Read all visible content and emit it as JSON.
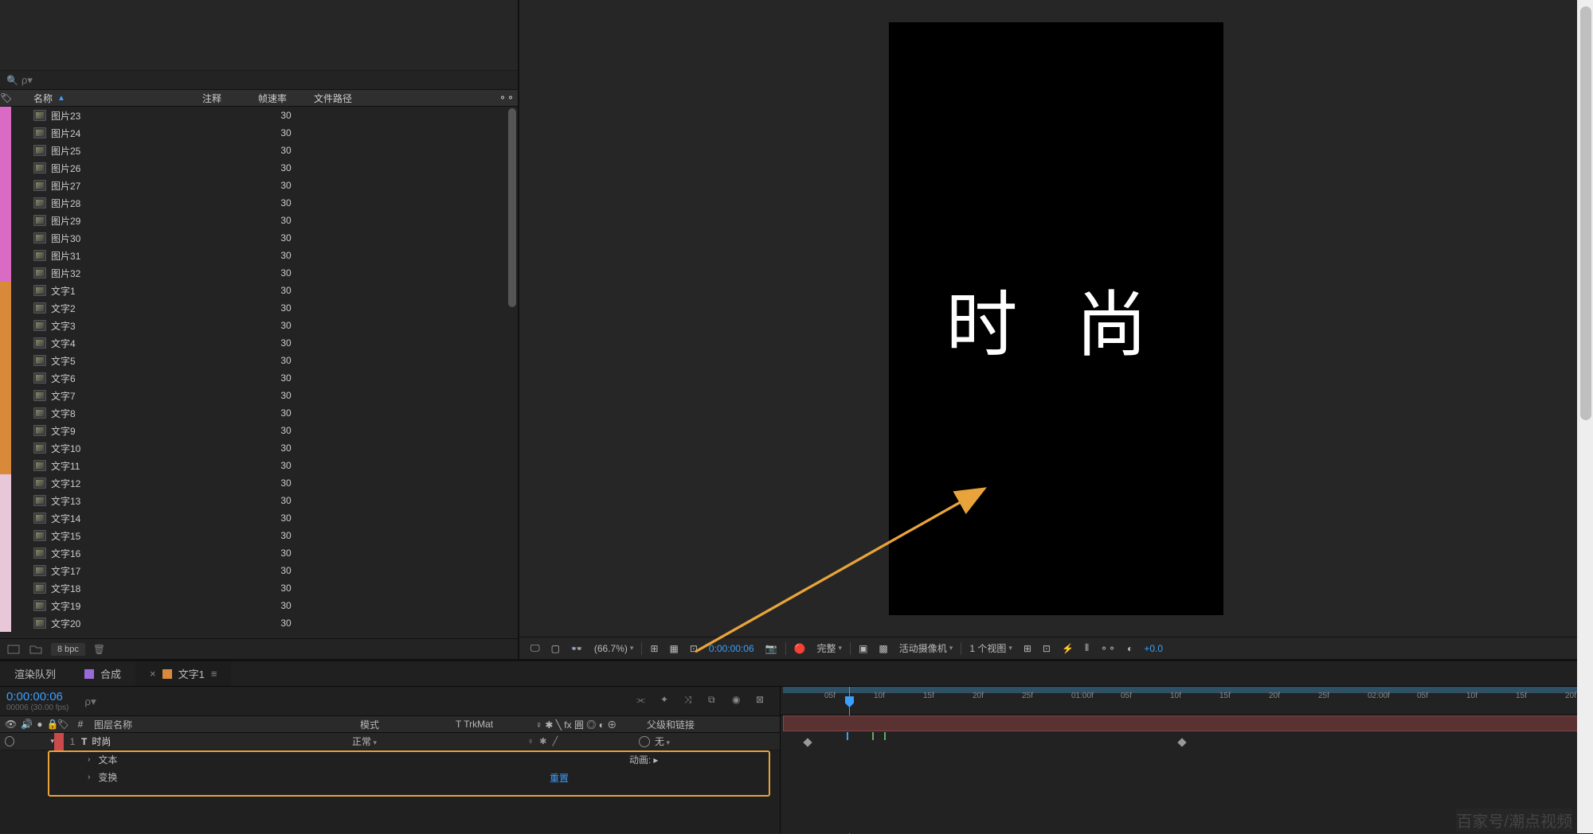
{
  "project": {
    "search_placeholder": "ρ▾",
    "columns": {
      "name": "名称",
      "comment": "注释",
      "fps": "帧速率",
      "path": "文件路径"
    },
    "items": [
      {
        "label": "#d96bc4",
        "name": "图片23",
        "fps": "30"
      },
      {
        "label": "#d96bc4",
        "name": "图片24",
        "fps": "30"
      },
      {
        "label": "#d96bc4",
        "name": "图片25",
        "fps": "30"
      },
      {
        "label": "#d96bc4",
        "name": "图片26",
        "fps": "30"
      },
      {
        "label": "#d96bc4",
        "name": "图片27",
        "fps": "30"
      },
      {
        "label": "#d96bc4",
        "name": "图片28",
        "fps": "30"
      },
      {
        "label": "#d96bc4",
        "name": "图片29",
        "fps": "30"
      },
      {
        "label": "#d96bc4",
        "name": "图片30",
        "fps": "30"
      },
      {
        "label": "#d96bc4",
        "name": "图片31",
        "fps": "30"
      },
      {
        "label": "#d96bc4",
        "name": "图片32",
        "fps": "30"
      },
      {
        "label": "#d88a3a",
        "name": "文字1",
        "fps": "30"
      },
      {
        "label": "#d88a3a",
        "name": "文字2",
        "fps": "30"
      },
      {
        "label": "#d88a3a",
        "name": "文字3",
        "fps": "30"
      },
      {
        "label": "#d88a3a",
        "name": "文字4",
        "fps": "30"
      },
      {
        "label": "#d88a3a",
        "name": "文字5",
        "fps": "30"
      },
      {
        "label": "#d88a3a",
        "name": "文字6",
        "fps": "30"
      },
      {
        "label": "#d88a3a",
        "name": "文字7",
        "fps": "30"
      },
      {
        "label": "#d88a3a",
        "name": "文字8",
        "fps": "30"
      },
      {
        "label": "#d88a3a",
        "name": "文字9",
        "fps": "30"
      },
      {
        "label": "#d88a3a",
        "name": "文字10",
        "fps": "30"
      },
      {
        "label": "#d88a3a",
        "name": "文字11",
        "fps": "30"
      },
      {
        "label": "#e8c8d8",
        "name": "文字12",
        "fps": "30"
      },
      {
        "label": "#e8c8d8",
        "name": "文字13",
        "fps": "30"
      },
      {
        "label": "#e8c8d8",
        "name": "文字14",
        "fps": "30"
      },
      {
        "label": "#e8c8d8",
        "name": "文字15",
        "fps": "30"
      },
      {
        "label": "#e8c8d8",
        "name": "文字16",
        "fps": "30"
      },
      {
        "label": "#e8c8d8",
        "name": "文字17",
        "fps": "30"
      },
      {
        "label": "#e8c8d8",
        "name": "文字18",
        "fps": "30"
      },
      {
        "label": "#e8c8d8",
        "name": "文字19",
        "fps": "30"
      },
      {
        "label": "#e8c8d8",
        "name": "文字20",
        "fps": "30"
      }
    ],
    "footer": {
      "bpc": "8 bpc"
    }
  },
  "viewer": {
    "canvas_text": "时 尚",
    "zoom": "(66.7%)",
    "timecode": "0:00:00:06",
    "resolution": "完整",
    "camera": "活动摄像机",
    "views": "1 个视图",
    "exposure": "+0.0"
  },
  "timeline": {
    "tabs": [
      {
        "label": "渲染队列",
        "color": ""
      },
      {
        "label": "合成",
        "color": "#9a6bd8"
      },
      {
        "label": "文字1",
        "color": "#d88a3a",
        "active": true
      }
    ],
    "timecode": "0:00:00:06",
    "framecount": "00006 (30.00 fps)",
    "search_placeholder": "ρ▾",
    "headers": {
      "num": "#",
      "layer_name": "图层名称",
      "mode": "模式",
      "trkmat": "T  TrkMat",
      "switches": "♀ ✱ ╲ fx 圓 ◎ ◐ ⊕",
      "parent": "父级和链接"
    },
    "layer1": {
      "num": "1",
      "type_glyph": "T",
      "name": "时尚",
      "mode": "正常",
      "parent_value": "无"
    },
    "subs": {
      "text": "文本",
      "transform": "变换",
      "reset": "重置",
      "animation": "动画:"
    },
    "ruler_ticks": [
      "05f",
      "10f",
      "15f",
      "20f",
      "25f",
      "01:00f",
      "05f",
      "10f",
      "15f",
      "20f",
      "25f",
      "02:00f",
      "05f",
      "10f",
      "15f",
      "20f"
    ]
  },
  "watermark": "百家号/潮点视频"
}
